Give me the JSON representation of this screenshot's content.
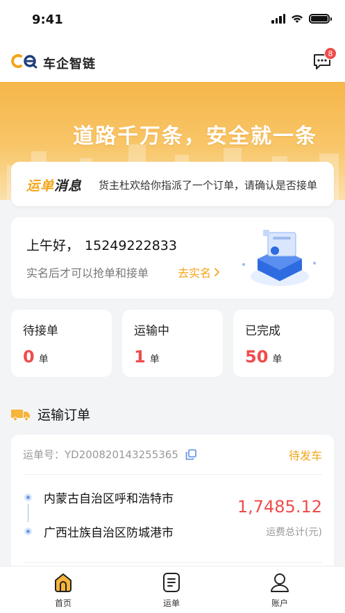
{
  "status_bar": {
    "time": "9:41"
  },
  "header": {
    "app_name": "车企智链",
    "message_badge": "8"
  },
  "banner": {
    "slogan": "道路千万条，安全就一条"
  },
  "notice": {
    "title_prefix": "运单",
    "title_suffix": "消息",
    "text": "货主杜欢给你指派了一个订单，请确认是否接单"
  },
  "greeting": {
    "hello": "上午好，",
    "phone": "15249222833",
    "verify_tip": "实名后才可以抢单和接单",
    "verify_link": "去实名"
  },
  "stats": [
    {
      "label": "待接单",
      "value": "0",
      "unit": "单"
    },
    {
      "label": "运输中",
      "value": "1",
      "unit": "单"
    },
    {
      "label": "已完成",
      "value": "50",
      "unit": "单"
    }
  ],
  "orders_section": {
    "title": "运输订单"
  },
  "order": {
    "number_label": "运单号：",
    "number": "YD200820143255365",
    "status": "待发车",
    "from": "内蒙古自治区呼和浩特市",
    "to": "广西壮族自治区防城港市",
    "fee": "1,7485.12",
    "fee_label": "运费总计(元)"
  },
  "tabbar": {
    "items": [
      {
        "label": "首页",
        "icon": "home-icon"
      },
      {
        "label": "运单",
        "icon": "waybill-icon"
      },
      {
        "label": "账户",
        "icon": "account-icon"
      }
    ]
  },
  "colors": {
    "accent": "#f2a519",
    "red": "#ef4c4c",
    "banner": "#f6b64a"
  }
}
